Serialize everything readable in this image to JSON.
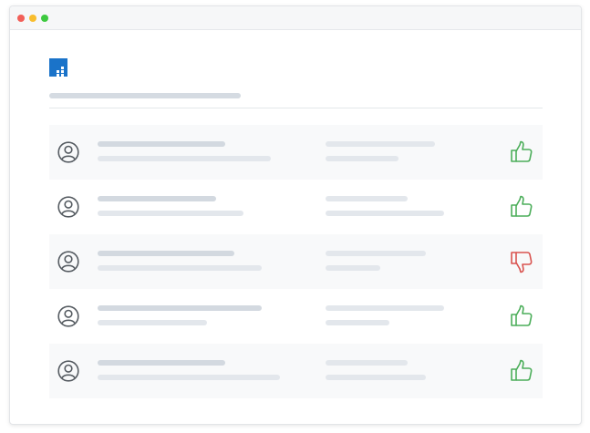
{
  "window": {
    "controls": [
      {
        "name": "close",
        "color": "#f25f58"
      },
      {
        "name": "minimize",
        "color": "#f8bd2e"
      },
      {
        "name": "maximize",
        "color": "#3dc93f"
      }
    ]
  },
  "brand": {
    "logo_icon": "grid-logo-icon",
    "logo_color": "#1a73c9"
  },
  "colors": {
    "thumbs_up": "#4cae5a",
    "thumbs_down": "#d9534f",
    "avatar": "#555b61"
  },
  "rows": [
    {
      "avatar_icon": "user-avatar-icon",
      "rating": "up",
      "rating_icon": "thumbs-up-icon"
    },
    {
      "avatar_icon": "user-avatar-icon",
      "rating": "up",
      "rating_icon": "thumbs-up-icon"
    },
    {
      "avatar_icon": "user-avatar-icon",
      "rating": "down",
      "rating_icon": "thumbs-down-icon"
    },
    {
      "avatar_icon": "user-avatar-icon",
      "rating": "up",
      "rating_icon": "thumbs-up-icon"
    },
    {
      "avatar_icon": "user-avatar-icon",
      "rating": "up",
      "rating_icon": "thumbs-up-icon"
    }
  ]
}
